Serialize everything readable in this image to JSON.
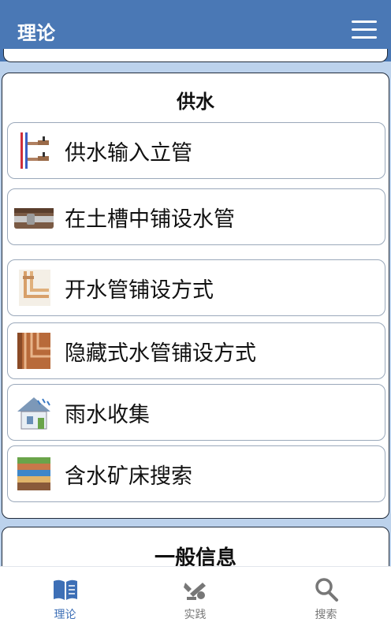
{
  "header": {
    "title": "理论",
    "menu_icon": "hamburger-menu-icon"
  },
  "section": {
    "title": "供水",
    "items": [
      {
        "label": "供水输入立管",
        "icon": "riser-pipe-icon"
      },
      {
        "label": "在土槽中铺设水管",
        "icon": "trench-pipe-icon"
      },
      {
        "label": "开水管铺设方式",
        "icon": "open-pipe-icon"
      },
      {
        "label": "隐藏式水管铺设方式",
        "icon": "hidden-pipe-icon"
      },
      {
        "label": "雨水收集",
        "icon": "rain-house-icon"
      },
      {
        "label": "含水矿床搜索",
        "icon": "aquifer-layers-icon"
      }
    ]
  },
  "next_section": {
    "title": "一般信息"
  },
  "tabbar": {
    "tabs": [
      {
        "label": "理论",
        "icon": "book-icon",
        "active": true
      },
      {
        "label": "实践",
        "icon": "tools-icon",
        "active": false
      },
      {
        "label": "搜索",
        "icon": "search-icon",
        "active": false
      }
    ]
  },
  "colors": {
    "header": "#4a78b5",
    "background": "#bcd2ec",
    "active_tab": "#3d6fb6"
  }
}
